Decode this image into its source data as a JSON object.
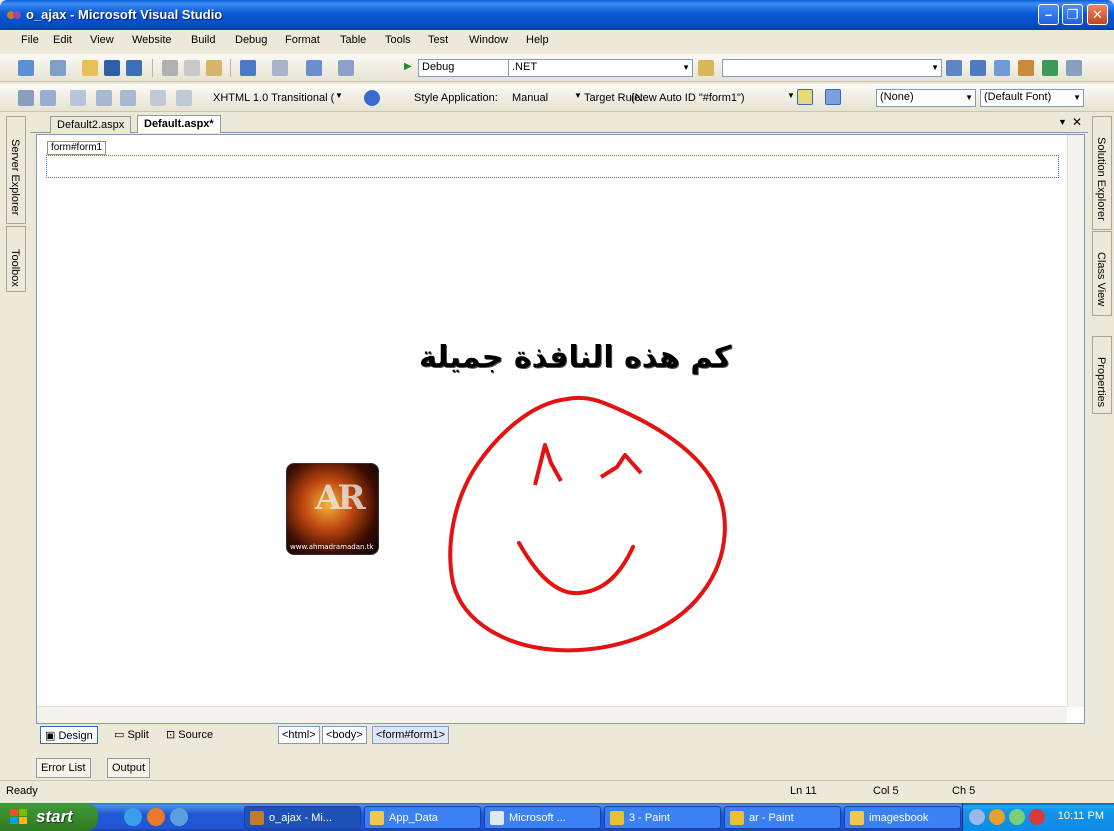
{
  "window": {
    "title": "o_ajax - Microsoft Visual Studio"
  },
  "menu": [
    "File",
    "Edit",
    "View",
    "Website",
    "Build",
    "Debug",
    "Format",
    "Table",
    "Tools",
    "Test",
    "Window",
    "Help"
  ],
  "toolbar1": {
    "config": "Debug",
    "platform": ".NET"
  },
  "toolbar2": {
    "doctype": "XHTML 1.0 Transitional (",
    "style_app_label": "Style Application:",
    "style_app_value": "Manual",
    "target_rule_label": "Target Rule:",
    "target_rule_value": "(New Auto ID \"#form1\")",
    "font_name": "(None)",
    "font_size": "(Default Font)"
  },
  "left_panels": [
    "Server Explorer",
    "Toolbox"
  ],
  "right_panels": [
    "Solution Explorer",
    "Class View",
    "Properties"
  ],
  "tabs": [
    "Default2.aspx",
    "Default.aspx*"
  ],
  "design": {
    "form_tag": "form#form1",
    "arabic_text": "كم هذه النافذة جميلة",
    "logo_site": "www.ahmadramadan.tk",
    "logo_letters": "AR"
  },
  "view_bar": {
    "design": "Design",
    "split": "Split",
    "source": "Source",
    "crumbs": [
      "<html>",
      "<body>",
      "<form#form1>"
    ]
  },
  "bottom_tabs": [
    "Error List",
    "Output"
  ],
  "status": {
    "ready": "Ready",
    "ln": "Ln 11",
    "col": "Col 5",
    "ch": "Ch 5"
  },
  "taskbar": {
    "start": "start",
    "tasks": [
      "o_ajax - Mi...",
      "App_Data",
      "Microsoft ...",
      "3 - Paint",
      "ar - Paint",
      "imagesbook"
    ],
    "clock": "10:11 PM"
  },
  "colors": {
    "smiley": "#e31313",
    "title_blue": "#0a58d4",
    "start_green": "#3a8a2e"
  }
}
